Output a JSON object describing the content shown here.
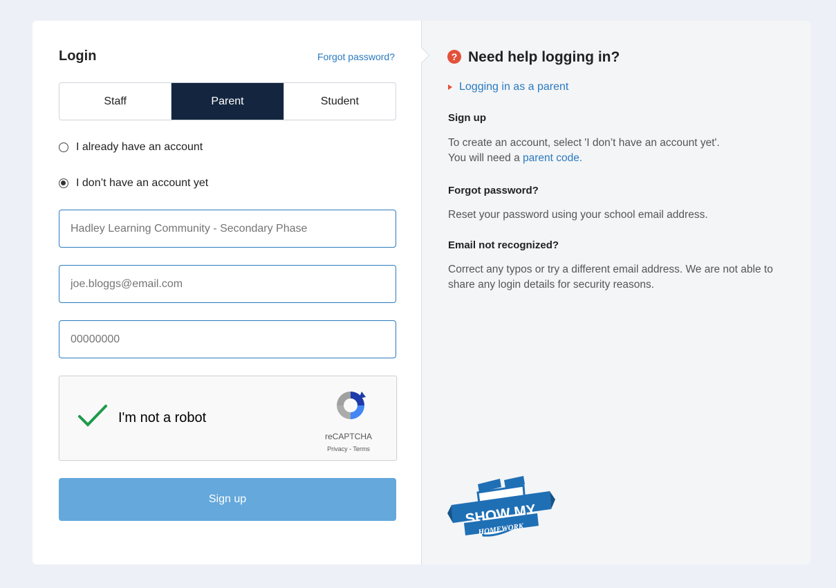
{
  "login": {
    "title": "Login",
    "forgot_link": "Forgot password?",
    "tabs": [
      {
        "label": "Staff",
        "active": false
      },
      {
        "label": "Parent",
        "active": true
      },
      {
        "label": "Student",
        "active": false
      }
    ],
    "radio_options": [
      {
        "label": "I already have an account",
        "checked": false
      },
      {
        "label": "I don’t have an account yet",
        "checked": true
      }
    ],
    "fields": {
      "school": {
        "value": "",
        "placeholder": "Hadley Learning Community - Secondary Phase"
      },
      "email": {
        "value": "",
        "placeholder": "joe.bloggs@email.com"
      },
      "parent_code": {
        "value": "",
        "placeholder": "00000000"
      }
    },
    "captcha": {
      "label": "I'm not a robot",
      "brand": "reCAPTCHA",
      "links": "Privacy - Terms",
      "checked": true
    },
    "signup_button": "Sign up"
  },
  "help": {
    "icon": "question-circle-icon",
    "title": "Need help logging in?",
    "link": "Logging in as a parent",
    "sections": {
      "signup_heading": "Sign up",
      "signup_text_1": "To create an account, select 'I don’t have an account yet'.",
      "signup_text_2_prefix": "You will need a ",
      "signup_text_2_link": "parent code.",
      "forgot_heading": "Forgot password?",
      "forgot_text": "Reset your password using your school email address.",
      "email_heading": "Email not recognized?",
      "email_text": "Correct any typos or try a different email address. We are not able to share any login details for security reasons."
    },
    "logo": {
      "line1": "SHOW MY",
      "line2": "HOMEWORK"
    }
  },
  "colors": {
    "accent": "#2a7abf",
    "active_tab": "#14263f",
    "signup_button": "#64a8dc",
    "help_icon": "#e2513a",
    "check": "#1e9a4b",
    "logo": "#1f6fb5"
  }
}
